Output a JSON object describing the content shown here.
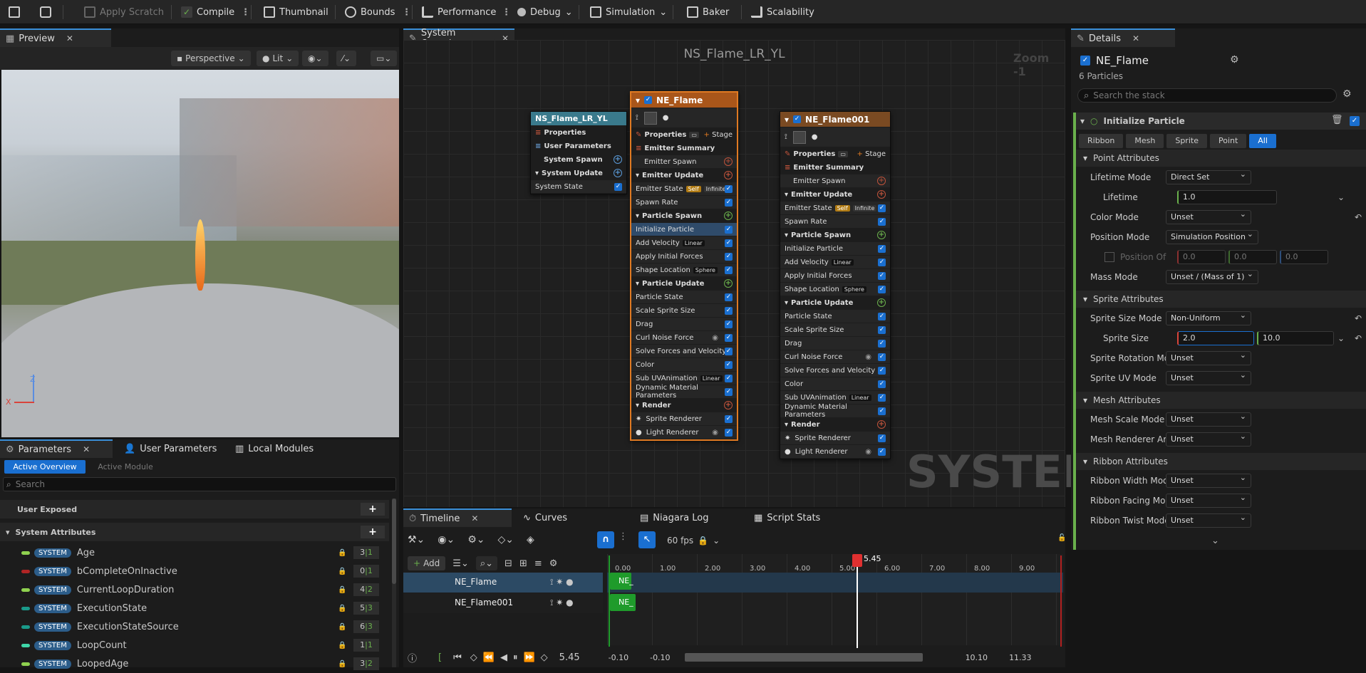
{
  "toolbar": {
    "apply_scratch": "Apply Scratch",
    "compile": "Compile",
    "thumbnail": "Thumbnail",
    "bounds": "Bounds",
    "performance": "Performance",
    "debug": "Debug",
    "simulation": "Simulation",
    "baker": "Baker",
    "scalability": "Scalability"
  },
  "preview": {
    "tab": "Preview",
    "perspective": "Perspective",
    "lit": "Lit",
    "axis_z": "Z",
    "axis_x": "X"
  },
  "system_overview": {
    "tab": "System Overview",
    "title": "NS_Flame_LR_YL",
    "zoom": "Zoom -1",
    "watermark": "SYSTEM"
  },
  "system_node": {
    "title": "NS_Flame_LR_YL",
    "rows": [
      "Properties",
      "User Parameters",
      "System Spawn",
      "System Update",
      "System State"
    ]
  },
  "emitter1": {
    "title": "NE_Flame",
    "properties": "Properties",
    "stage": "Stage",
    "emitter_summary": "Emitter Summary",
    "emitter_spawn": "Emitter Spawn",
    "emitter_update": "Emitter Update",
    "emitter_state": "Emitter State",
    "self": "Self",
    "infinite": "Infinite",
    "spawn_rate": "Spawn Rate",
    "particle_spawn": "Particle Spawn",
    "initialize_particle": "Initialize Particle",
    "add_velocity": "Add Velocity",
    "linear": "Linear",
    "apply_initial_forces": "Apply Initial Forces",
    "shape_location": "Shape Location",
    "sphere": "Sphere",
    "particle_update": "Particle Update",
    "particle_state": "Particle State",
    "scale_sprite_size": "Scale Sprite Size",
    "drag": "Drag",
    "curl_noise_force": "Curl Noise Force",
    "solve_forces": "Solve Forces and Velocity",
    "color": "Color",
    "sub_uv": "Sub UVAnimation",
    "dyn_mat": "Dynamic Material Parameters",
    "render": "Render",
    "sprite_renderer": "Sprite Renderer",
    "light_renderer": "Light Renderer"
  },
  "emitter2": {
    "title": "NE_Flame001"
  },
  "params": {
    "tab": "Parameters",
    "user_params_tab": "User Parameters",
    "local_modules_tab": "Local Modules",
    "active_overview": "Active Overview",
    "active_module": "Active Module",
    "search_placeholder": "Search",
    "user_exposed": "User Exposed",
    "system_attributes": "System Attributes",
    "pill": "SYSTEM",
    "items": [
      {
        "name": "Age",
        "count": "3",
        "count2": "1",
        "color": "#8fd14f"
      },
      {
        "name": "bCompleteOnInactive",
        "count": "0",
        "count2": "1",
        "color": "#b02525"
      },
      {
        "name": "CurrentLoopDuration",
        "count": "4",
        "count2": "2",
        "color": "#8fd14f"
      },
      {
        "name": "ExecutionState",
        "count": "5",
        "count2": "3",
        "color": "#1a9a8a"
      },
      {
        "name": "ExecutionStateSource",
        "count": "6",
        "count2": "3",
        "color": "#1a9a8a"
      },
      {
        "name": "LoopCount",
        "count": "1",
        "count2": "1",
        "color": "#3fd6a8"
      },
      {
        "name": "LoopedAge",
        "count": "3",
        "count2": "2",
        "color": "#8fd14f"
      }
    ]
  },
  "timeline": {
    "tab": "Timeline",
    "curves": "Curves",
    "niagara_log": "Niagara Log",
    "script_stats": "Script Stats",
    "fps": "60 fps",
    "add": "Add",
    "tracks": [
      "NE_Flame",
      "NE_Flame001"
    ],
    "clip": "NE_",
    "playhead": "5.45",
    "ticks": [
      "0.00",
      "1.00",
      "2.00",
      "3.00",
      "4.00",
      "5.00",
      "6.00",
      "7.00",
      "8.00",
      "9.00"
    ],
    "time": "5.45",
    "range_start": "-0.10",
    "range_start2": "-0.10",
    "range_end": "10.10",
    "range_end2": "11.33"
  },
  "details": {
    "tab": "Details",
    "emitter": "NE_Flame",
    "particles": "6 Particles",
    "search_placeholder": "Search the stack",
    "module": "Initialize Particle",
    "filters": [
      "Ribbon",
      "Mesh",
      "Sprite",
      "Point",
      "All"
    ],
    "point_attributes": "Point Attributes",
    "lifetime_mode_label": "Lifetime Mode",
    "lifetime_mode": "Direct Set",
    "lifetime_label": "Lifetime",
    "lifetime": "1.0",
    "color_mode_label": "Color Mode",
    "color_mode": "Unset",
    "position_mode_label": "Position Mode",
    "position_mode": "Simulation Position",
    "position_offset_label": "Position Of",
    "pos_x": "0.0",
    "pos_y": "0.0",
    "pos_z": "0.0",
    "mass_mode_label": "Mass Mode",
    "mass_mode": "Unset / (Mass of 1)",
    "sprite_attributes": "Sprite Attributes",
    "sprite_size_mode_label": "Sprite Size Mode",
    "sprite_size_mode": "Non-Uniform",
    "sprite_size_label": "Sprite Size",
    "sprite_size_x": "2.0",
    "sprite_size_y": "10.0",
    "sprite_rot_label": "Sprite Rotation Mo",
    "sprite_rot": "Unset",
    "sprite_uv_label": "Sprite UV Mode",
    "sprite_uv": "Unset",
    "mesh_attributes": "Mesh Attributes",
    "mesh_scale_label": "Mesh Scale Mode",
    "mesh_scale": "Unset",
    "mesh_renderer_label": "Mesh Renderer Arr",
    "mesh_renderer": "Unset",
    "ribbon_attributes": "Ribbon Attributes",
    "ribbon_width_label": "Ribbon Width Mode",
    "ribbon_width": "Unset",
    "ribbon_facing_label": "Ribbon Facing Mod",
    "ribbon_facing": "Unset",
    "ribbon_twist_label": "Ribbon Twist Mode",
    "ribbon_twist": "Unset"
  }
}
